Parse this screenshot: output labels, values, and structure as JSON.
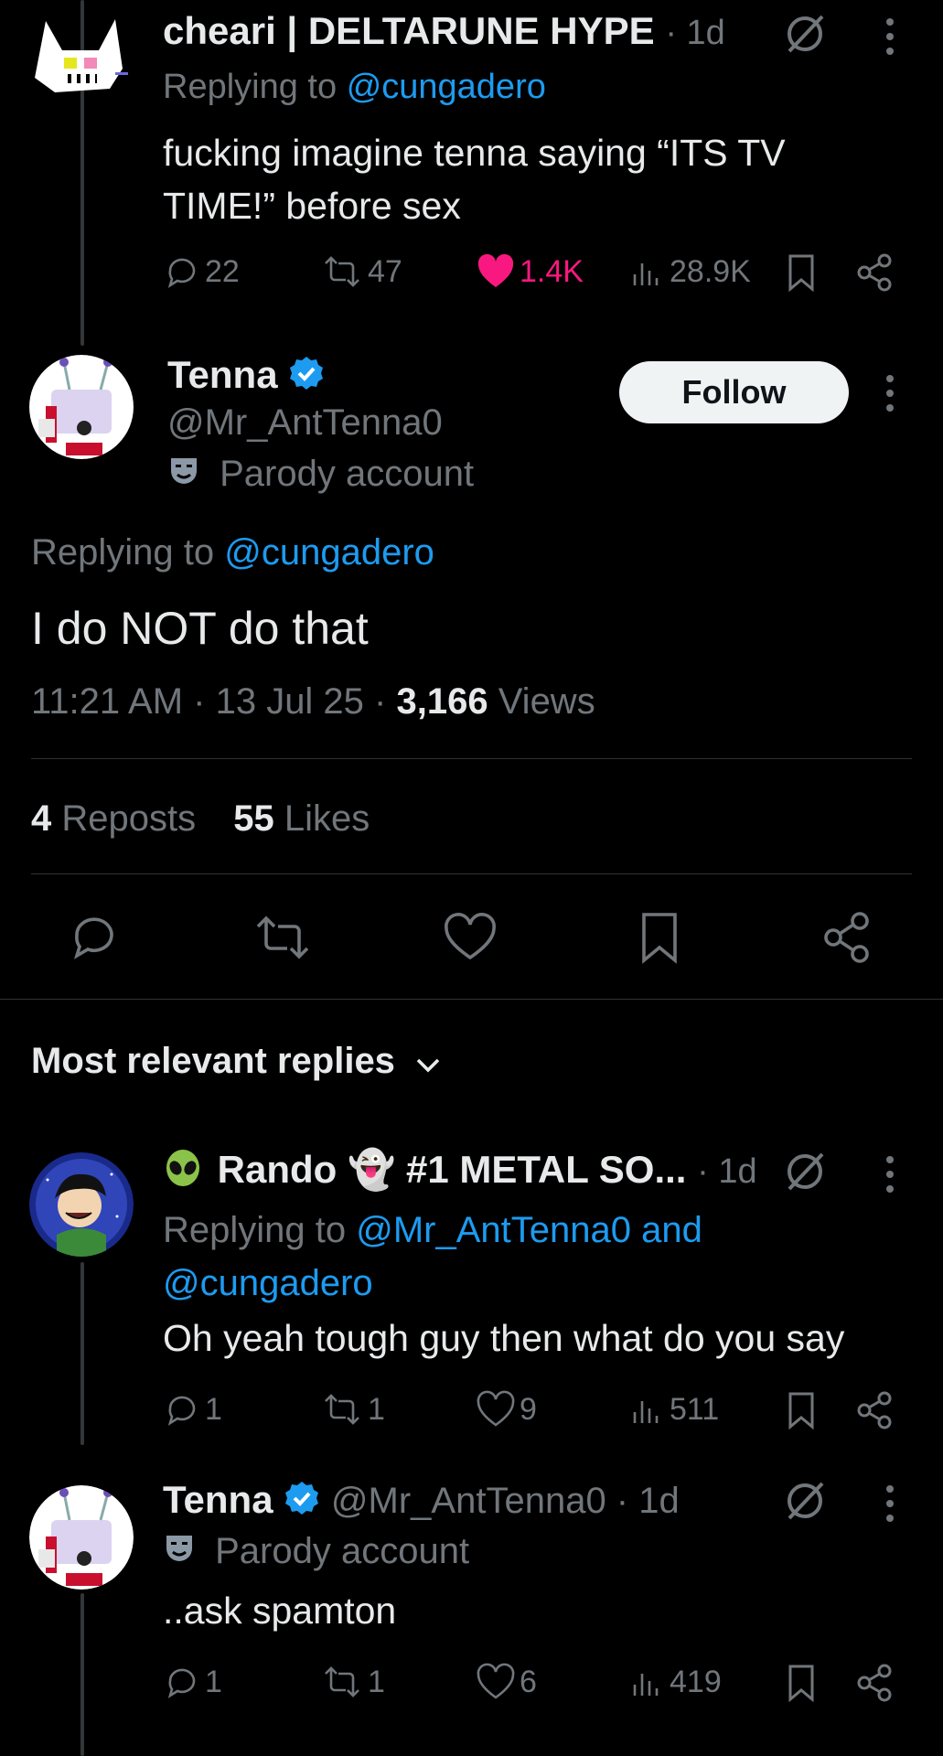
{
  "reply1": {
    "name": "cheari | DELTARUNE HYPE",
    "time": "· 1d",
    "replying_prefix": "Replying to",
    "replying_handle": "@cungadero",
    "text_line1": "fucking imagine tenna saying “ITS TV",
    "text_line2": "TIME!” before sex",
    "replies": "22",
    "reposts": "47",
    "likes": "1.4K",
    "views": "28.9K"
  },
  "main": {
    "name": "Tenna",
    "handle": "@Mr_AntTenna0",
    "parody": "Parody account",
    "follow_label": "Follow",
    "replying_prefix": "Replying to",
    "replying_handle": "@cungadero",
    "text": "I do NOT do that",
    "time": "11:21 AM · 13 Jul 25 ·",
    "views_count": "3,166",
    "views_label": "Views",
    "reposts_count": "4",
    "reposts_label": "Reposts",
    "likes_count": "55",
    "likes_label": "Likes"
  },
  "section": {
    "sort_label": "Most relevant replies"
  },
  "reply2": {
    "name": "Rando 👻 #1 METAL SO...",
    "time": "· 1d",
    "replying_prefix": "Replying to",
    "replying_handles": "@Mr_AntTenna0 and",
    "replying_handles2": "@cungadero",
    "text": "Oh yeah tough guy then what do you say",
    "replies": "1",
    "reposts": "1",
    "likes": "9",
    "views": "511"
  },
  "reply3": {
    "name": "Tenna",
    "handle_time": "@Mr_AntTenna0 · 1d",
    "parody": "Parody account",
    "text": "..ask spamton",
    "replies": "1",
    "reposts": "1",
    "likes": "6",
    "views": "419"
  },
  "colors": {
    "accent": "#1d9bf0",
    "like_active": "#f91880",
    "text": "#e7e9ea",
    "muted": "#71767b"
  }
}
